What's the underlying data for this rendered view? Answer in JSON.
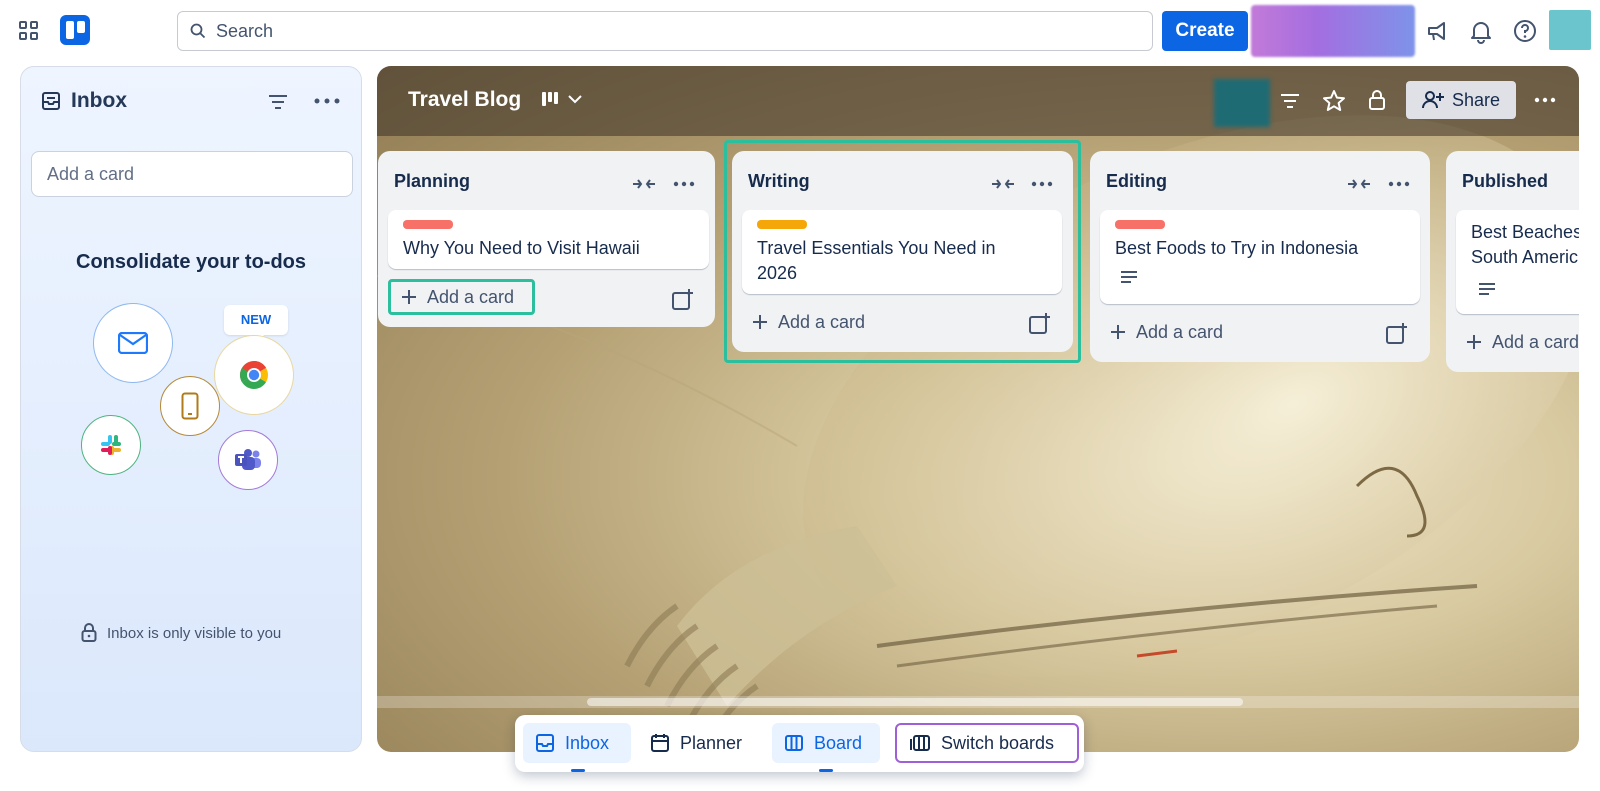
{
  "topbar": {
    "search_placeholder": "Search",
    "create_label": "Create"
  },
  "inbox": {
    "title": "Inbox",
    "add_card_placeholder": "Add a card",
    "consolidate_heading": "Consolidate your to-dos",
    "new_tag": "NEW",
    "privacy_note": "Inbox is only visible to you"
  },
  "board": {
    "title": "Travel Blog",
    "share_label": "Share",
    "lists": [
      {
        "title": "Planning",
        "cards": [
          {
            "label_color": "#f87168",
            "text": "Why You Need to Visit Hawaii"
          }
        ],
        "add_card_label": "Add a card"
      },
      {
        "title": "Writing",
        "cards": [
          {
            "label_color": "#f5a70a",
            "text_line1": "Travel Essentials You Need in",
            "text_line2": "2026"
          }
        ],
        "add_card_label": "Add a card"
      },
      {
        "title": "Editing",
        "cards": [
          {
            "label_color": "#f87168",
            "text": "Best Foods to Try in Indonesia"
          }
        ],
        "add_card_label": "Add a card"
      },
      {
        "title": "Published",
        "cards": [
          {
            "text_line1": "Best Beaches",
            "text_line2": "South Americ"
          }
        ],
        "add_card_label": "Add a card"
      }
    ]
  },
  "bottomnav": {
    "inbox": "Inbox",
    "planner": "Planner",
    "board": "Board",
    "switch_boards": "Switch boards"
  }
}
